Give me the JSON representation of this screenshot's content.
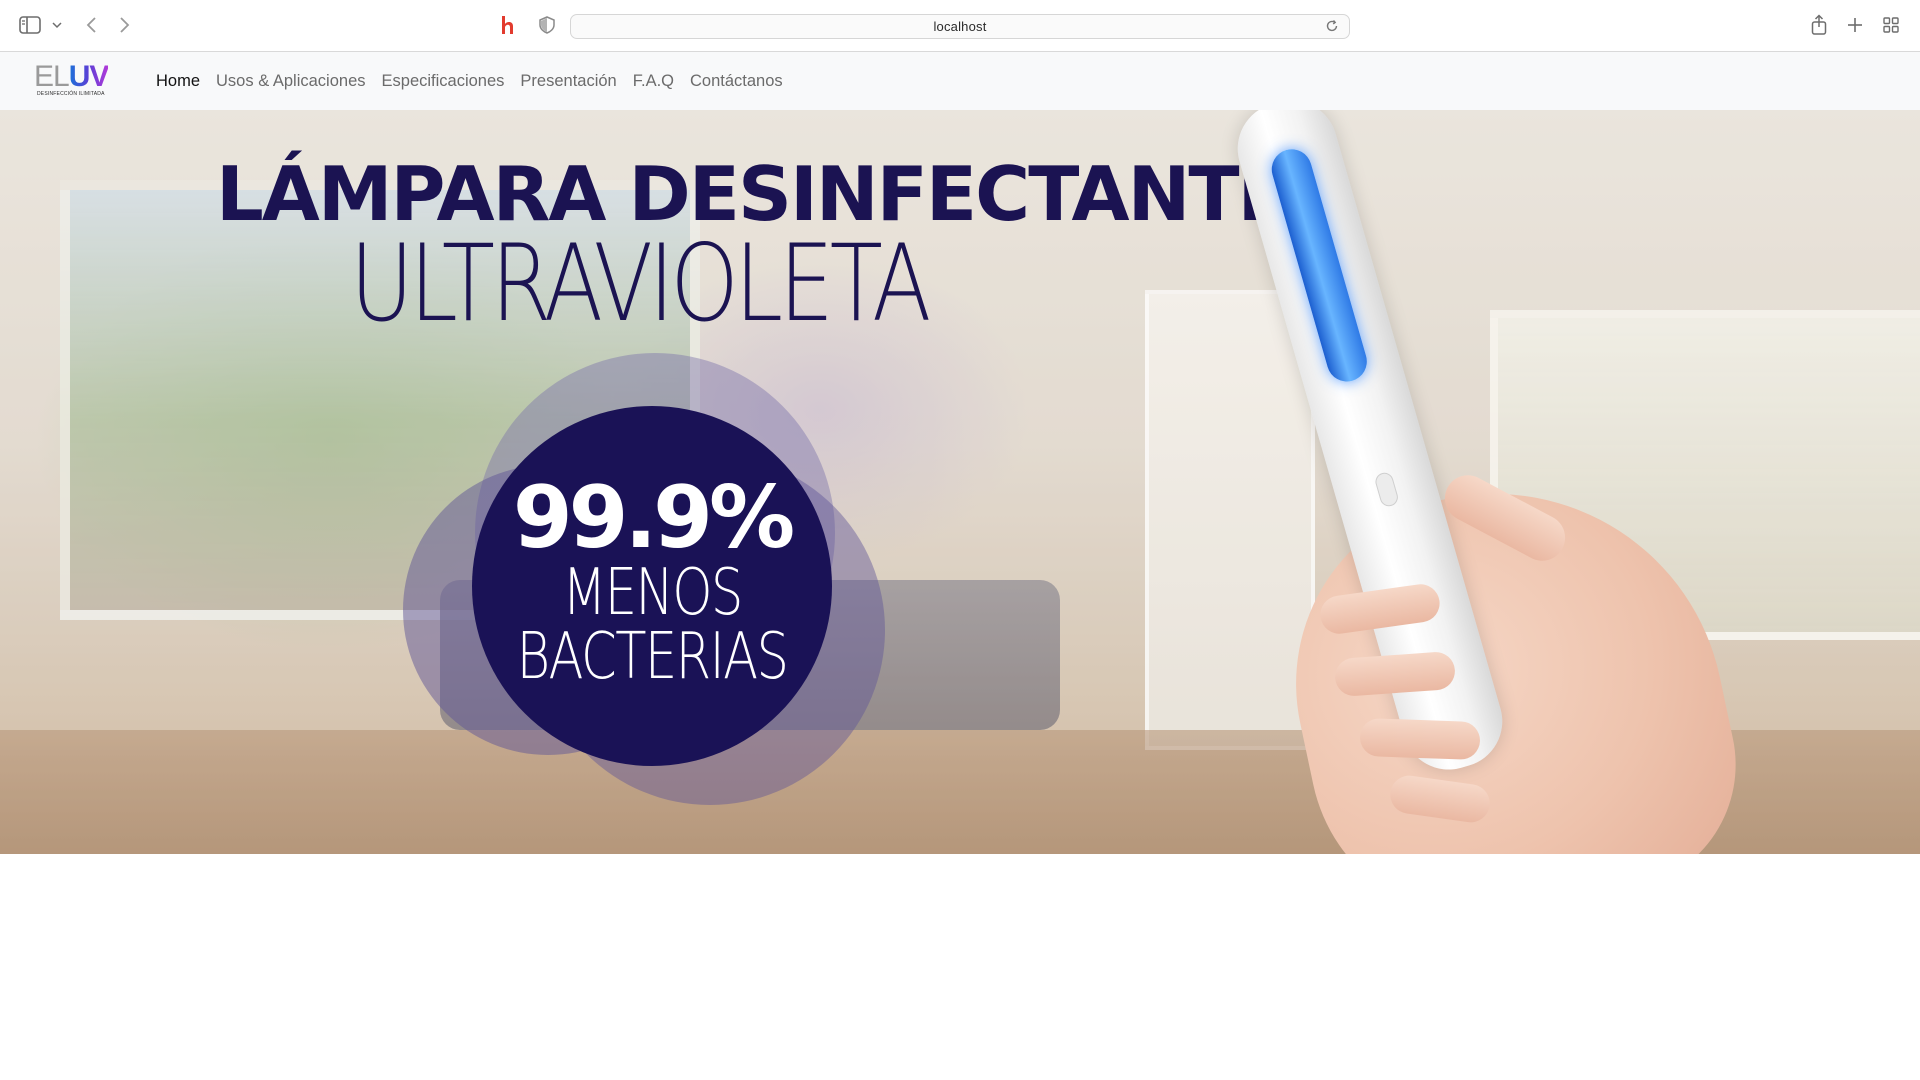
{
  "browser": {
    "url": "localhost",
    "icons": {
      "sidebar_toggle": "sidebar-icon",
      "sidebar_menu": "chevron-down-icon",
      "back": "chevron-left-icon",
      "forward": "chevron-right-icon",
      "extension": "honey-extension-icon",
      "privacy": "shield-icon",
      "reload": "reload-icon",
      "share": "share-icon",
      "new_tab": "plus-icon",
      "tab_overview": "grid-icon"
    }
  },
  "site": {
    "logo": {
      "mark_el": "EL",
      "mark_uv": "UV",
      "tagline": "DESINFECCIÓN ILIMITADA"
    },
    "nav": [
      {
        "label": "Home",
        "active": true
      },
      {
        "label": "Usos & Aplicaciones",
        "active": false
      },
      {
        "label": "Especificaciones",
        "active": false
      },
      {
        "label": "Presentación",
        "active": false
      },
      {
        "label": "F.A.Q",
        "active": false
      },
      {
        "label": "Contáctanos",
        "active": false
      }
    ]
  },
  "hero": {
    "title_line_1": "LÁMPARA DESINFECTANTE",
    "title_line_2": "ULTRAVIOLETA",
    "badge": {
      "percent": "99.9%",
      "line_1": "MENOS",
      "line_2": "BACTERIAS"
    },
    "colors": {
      "title": "#1b1352",
      "badge_fill": "#1a1256",
      "uv_glow": "#3a8cff"
    }
  }
}
